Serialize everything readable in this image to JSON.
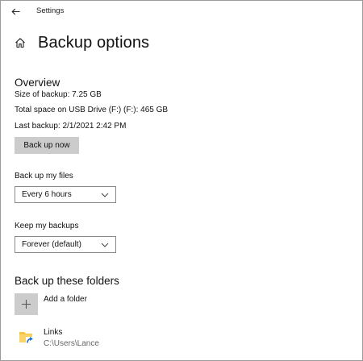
{
  "window": {
    "title": "Settings"
  },
  "page": {
    "title": "Backup options"
  },
  "overview": {
    "heading": "Overview",
    "size": "Size of backup: 7.25 GB",
    "total_space": "Total space on USB Drive (F:) (F:): 465 GB",
    "last_backup": "Last backup: 2/1/2021 2:42 PM",
    "backup_button": "Back up now"
  },
  "backup_files": {
    "label": "Back up my files",
    "selected": "Every 6 hours"
  },
  "keep_backups": {
    "label": "Keep my backups",
    "selected": "Forever (default)"
  },
  "folders": {
    "heading": "Back up these folders",
    "add_label": "Add a folder",
    "items": [
      {
        "name": "Links",
        "path": "C:\\Users\\Lance"
      }
    ]
  },
  "icons": {
    "back": "back-arrow-icon",
    "home": "home-icon",
    "add": "plus-icon",
    "chevron": "chevron-down-icon",
    "folder": "folder-shortcut-icon"
  },
  "colors": {
    "button_bg": "#cccccc",
    "folder_yellow": "#f5c542",
    "shortcut_blue": "#1f6fd6"
  }
}
